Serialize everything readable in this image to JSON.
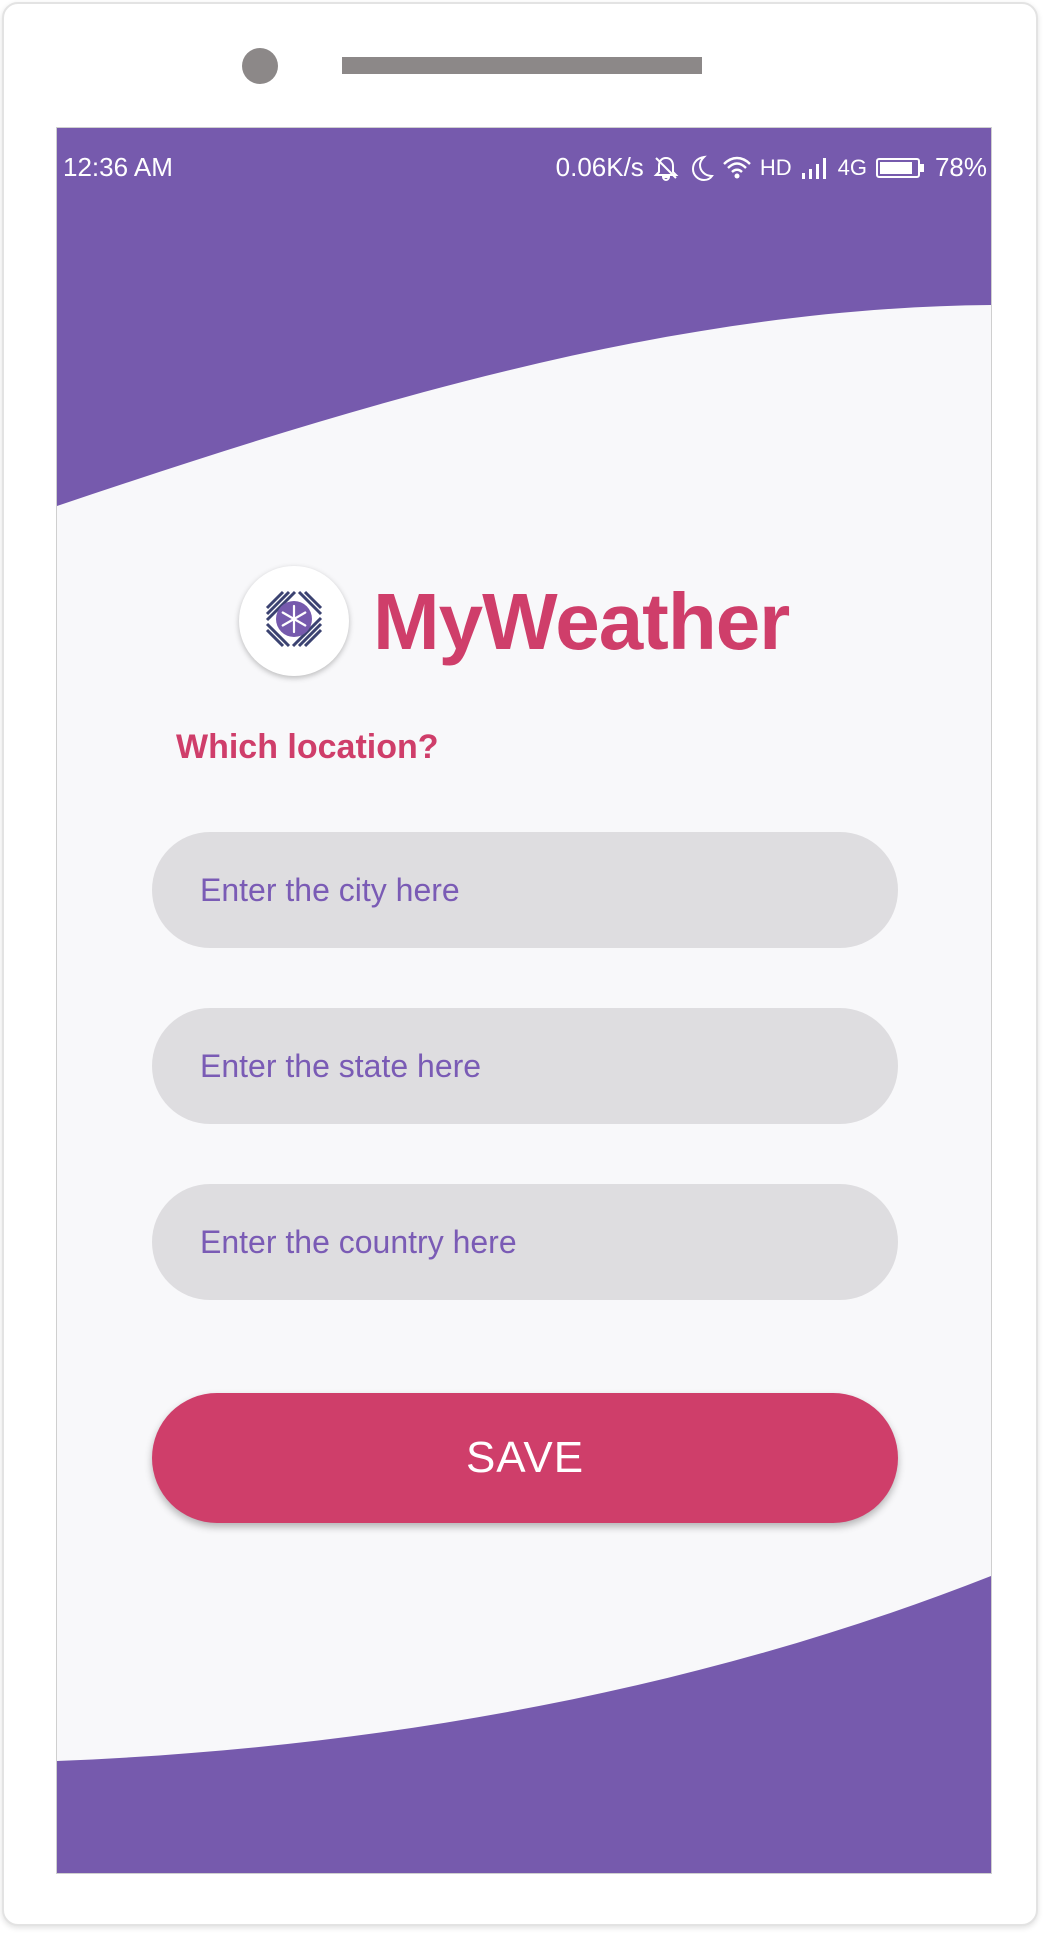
{
  "colors": {
    "primary_purple": "#765aad",
    "accent_pink": "#cf3e6a",
    "background": "#f8f8fa",
    "field_bg": "#dedde0"
  },
  "status_bar": {
    "time": "12:36 AM",
    "network_speed": "0.06K/s",
    "hd": "HD",
    "network_type": "4G",
    "battery": "78%",
    "icons": [
      "notifications-off-icon",
      "moon-icon",
      "wifi-icon",
      "signal-icon",
      "battery-icon"
    ]
  },
  "app": {
    "logo_icon": "snowflake-icon",
    "title": "MyWeather"
  },
  "form": {
    "question": "Which location?",
    "city_placeholder": "Enter the city here",
    "state_placeholder": "Enter the state here",
    "country_placeholder": "Enter the country here",
    "save_label": "SAVE"
  }
}
